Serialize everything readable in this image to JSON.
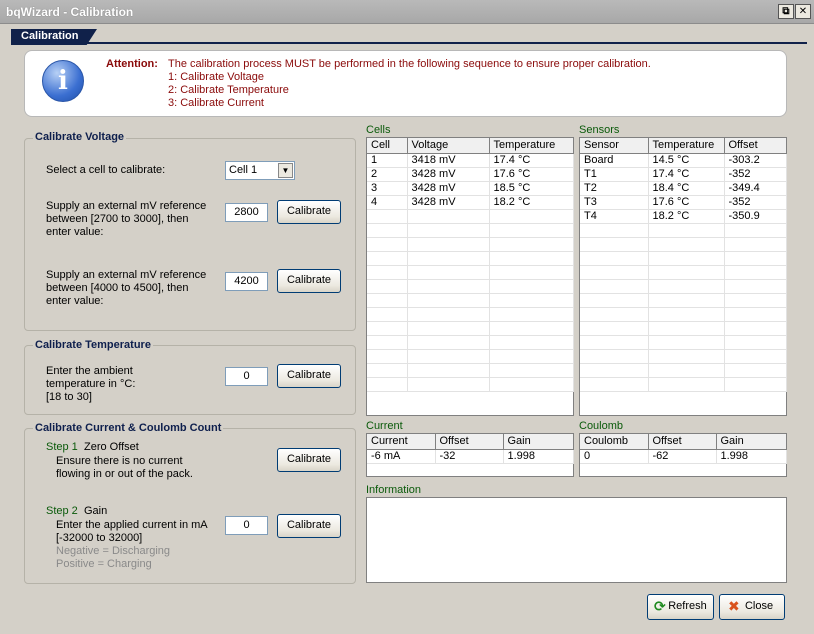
{
  "window": {
    "title": "bqWizard - Calibration",
    "restore_glyph": "⧉",
    "close_glyph": "✕"
  },
  "header": {
    "tab_label": "Calibration"
  },
  "attention": {
    "label": "Attention:",
    "lines": [
      "The calibration process MUST be performed in the following sequence to ensure proper calibration.",
      "1: Calibrate Voltage",
      "2: Calibrate Temperature",
      "3: Calibrate Current"
    ],
    "icon": "info-icon"
  },
  "voltage": {
    "title": "Calibrate Voltage",
    "select_label": "Select a cell to calibrate:",
    "select_value": "Cell 1",
    "low": {
      "line1": "Supply an external mV reference",
      "line2": "between [2700 to 3000], then",
      "line3": "enter value:",
      "value": "2800",
      "button": "Calibrate"
    },
    "high": {
      "line1": "Supply an external mV reference",
      "line2": "between [4000 to 4500], then",
      "line3": "enter value:",
      "value": "4200",
      "button": "Calibrate"
    }
  },
  "temperature": {
    "title": "Calibrate Temperature",
    "line1": "Enter the ambient",
    "line2": "temperature in °C:",
    "line3": "[18 to 30]",
    "value": "0",
    "button": "Calibrate"
  },
  "current_cal": {
    "title": "Calibrate Current & Coulomb Count",
    "step1": {
      "label": "Step 1",
      "name": "Zero Offset",
      "line1": "Ensure there is no current",
      "line2": "flowing in or out of the pack.",
      "button": "Calibrate"
    },
    "step2": {
      "label": "Step 2",
      "name": "Gain",
      "line1": "Enter the applied current in mA",
      "line2": "[-32000 to 32000]",
      "neg": "Negative = Discharging",
      "pos": "Positive = Charging",
      "value": "0",
      "button": "Calibrate"
    }
  },
  "cells": {
    "label": "Cells",
    "columns": [
      "Cell",
      "Voltage",
      "Temperature"
    ],
    "rows": [
      [
        "1",
        "3418 mV",
        "17.4 °C"
      ],
      [
        "2",
        "3428 mV",
        "17.6 °C"
      ],
      [
        "3",
        "3428 mV",
        "18.5 °C"
      ],
      [
        "4",
        "3428 mV",
        "18.2 °C"
      ]
    ]
  },
  "sensors": {
    "label": "Sensors",
    "columns": [
      "Sensor",
      "Temperature",
      "Offset"
    ],
    "rows": [
      [
        "Board",
        "14.5 °C",
        "-303.2"
      ],
      [
        "T1",
        "17.4 °C",
        "-352"
      ],
      [
        "T2",
        "18.4 °C",
        "-349.4"
      ],
      [
        "T3",
        "17.6 °C",
        "-352"
      ],
      [
        "T4",
        "18.2 °C",
        "-350.9"
      ]
    ]
  },
  "current": {
    "label": "Current",
    "columns": [
      "Current",
      "Offset",
      "Gain"
    ],
    "rows": [
      [
        "-6 mA",
        "-32",
        "1.998"
      ]
    ]
  },
  "coulomb": {
    "label": "Coulomb",
    "columns": [
      "Coulomb",
      "Offset",
      "Gain"
    ],
    "rows": [
      [
        "0",
        "-62",
        "1.998"
      ]
    ]
  },
  "information": {
    "label": "Information"
  },
  "footer": {
    "refresh_label": "Refresh",
    "close_label": "Close"
  }
}
